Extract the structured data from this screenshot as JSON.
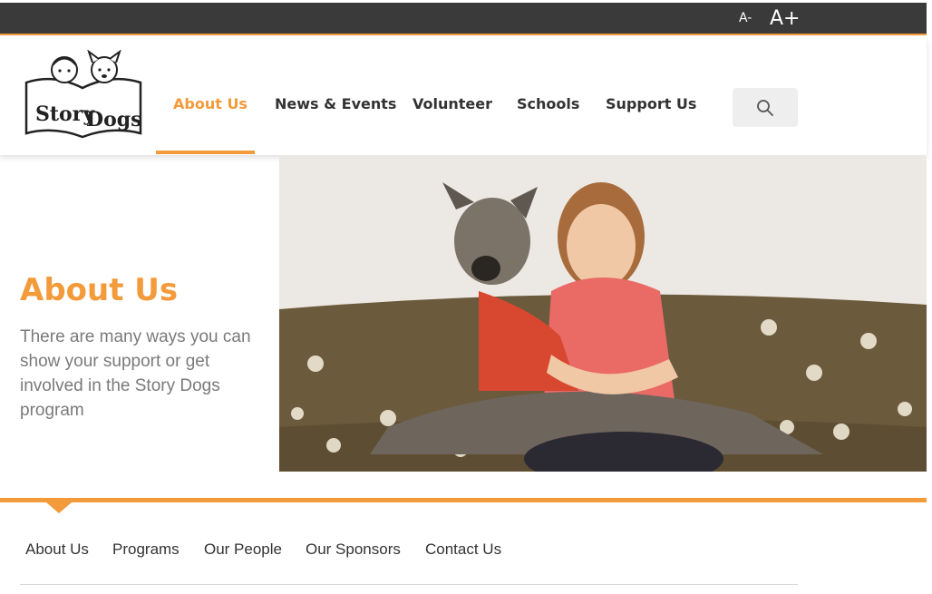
{
  "topbar": {
    "font_decrease": "A-",
    "font_increase": "A+"
  },
  "logo": {
    "text_line1": "Story",
    "text_line2": "Dogs"
  },
  "nav": {
    "items": [
      {
        "label": "About Us",
        "active": true
      },
      {
        "label": "News & Events",
        "active": false
      },
      {
        "label": "Volunteer",
        "active": false
      },
      {
        "label": "Schools",
        "active": false
      },
      {
        "label": "Support Us",
        "active": false
      }
    ],
    "search_icon": "search-icon"
  },
  "hero": {
    "title": "About Us",
    "description": "There are many ways you can show your support or get involved in the Story Dogs program"
  },
  "subnav": {
    "items": [
      {
        "label": "About Us"
      },
      {
        "label": "Programs"
      },
      {
        "label": "Our People"
      },
      {
        "label": "Our Sponsors"
      },
      {
        "label": "Contact Us"
      }
    ]
  },
  "colors": {
    "accent": "#f39a3b",
    "topbar": "#3a3a3a",
    "text": "#333333",
    "muted_text": "#7a7a7a"
  }
}
